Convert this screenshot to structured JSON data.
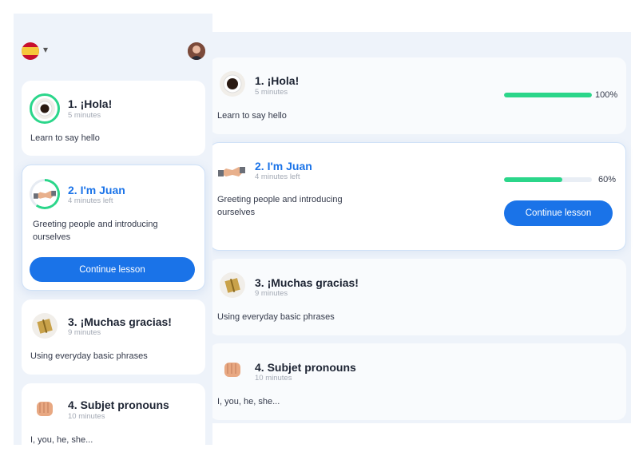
{
  "header": {
    "language_flag": "spain-flag-icon",
    "menu_chevron": "▾"
  },
  "lessons": [
    {
      "title": "1. ¡Hola!",
      "duration": "5 minutes",
      "description": "Learn to say hello",
      "progress": 100,
      "progress_label": "100%",
      "icon": "coffee-cup-icon"
    },
    {
      "title": "2. I'm Juan",
      "duration": "4 minutes left",
      "description": "Greeting people and introducing ourselves",
      "progress": 60,
      "progress_label": "60%",
      "icon": "handshake-icon",
      "button_label": "Continue lesson"
    },
    {
      "title": "3. ¡Muchas gracias!",
      "duration": "9 minutes",
      "description": "Using everyday basic phrases",
      "icon": "gift-icon"
    },
    {
      "title": "4. Subjet pronouns",
      "duration": "10 minutes",
      "description": "I, you, he, she...",
      "icon": "fist-icon"
    }
  ],
  "colors": {
    "accent": "#1a73e8",
    "progress": "#2bd68a",
    "panel": "#eef3fa"
  }
}
